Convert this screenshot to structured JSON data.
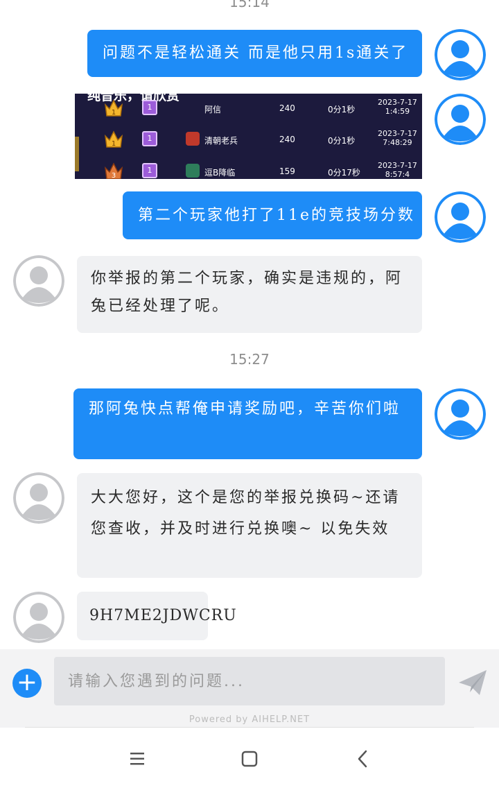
{
  "timestamps": {
    "top_partial": "15:14",
    "middle": "15:27"
  },
  "messages": {
    "m1": "问题不是轻松通关 而是他只用1s通关了",
    "m2": "第二个玩家他打了11e的竞技场分数",
    "r1": "你举报的第二个玩家，确实是违规的，阿兔已经处理了呢。",
    "m3": "那阿兔快点帮俺申请奖励吧，辛苦你们啦",
    "r2": "大大您好，这个是您的举报兑换码~还请您查收，并及时进行兑换噢~ 以免失效",
    "r3": "9H7ME2JDWCRU"
  },
  "screenshot": {
    "top_text": "纯音乐，请欣赏",
    "rows": [
      {
        "rank": "1",
        "level": "1",
        "player": "阿信",
        "score": "240",
        "time": "0分1秒",
        "date": "2023-7-17",
        "clock": "1:4:59"
      },
      {
        "rank": "1",
        "level": "1",
        "player": "清朝老兵",
        "score": "240",
        "time": "0分1秒",
        "date": "2023-7-17",
        "clock": "7:48:29"
      },
      {
        "rank": "3",
        "level": "1",
        "player": "逗B降临",
        "score": "159",
        "time": "0分17秒",
        "date": "2023-7-17",
        "clock": "8:57:4"
      }
    ]
  },
  "composer": {
    "placeholder": "请输入您遇到的问题...",
    "plus_label": "+",
    "powered_by": "Powered by AIHELP.NET"
  },
  "icons": {
    "avatar": "user-avatar-icon",
    "plus": "add-circle-icon",
    "send": "paper-plane-send-icon",
    "menu": "hamburger-menu-icon",
    "home": "square-home-icon",
    "back": "chevron-back-icon"
  },
  "colors": {
    "accent": "#1e8cf7",
    "agent_bubble": "#f0f1f3",
    "avatar_me": "#1e8cf7",
    "avatar_agent": "#c6c7ca"
  }
}
